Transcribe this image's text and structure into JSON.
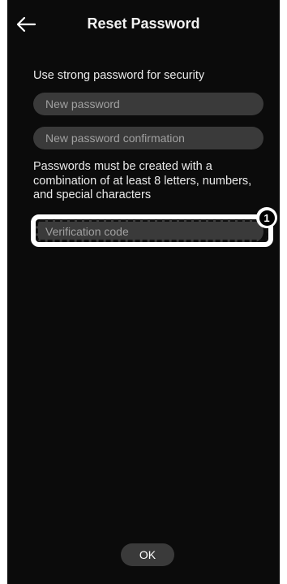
{
  "header": {
    "title": "Reset Password",
    "back_icon": "arrow-left-icon"
  },
  "form": {
    "subtitle": "Use strong password for security",
    "new_password_placeholder": "New password",
    "new_password_value": "",
    "confirm_password_placeholder": "New password confirmation",
    "confirm_password_value": "",
    "hint": "Passwords must be created with a combination of at least 8 letters, numbers, and special characters",
    "verification_code_placeholder": "Verification code",
    "verification_code_value": ""
  },
  "callout": {
    "number": "1"
  },
  "footer": {
    "ok_label": "OK"
  }
}
